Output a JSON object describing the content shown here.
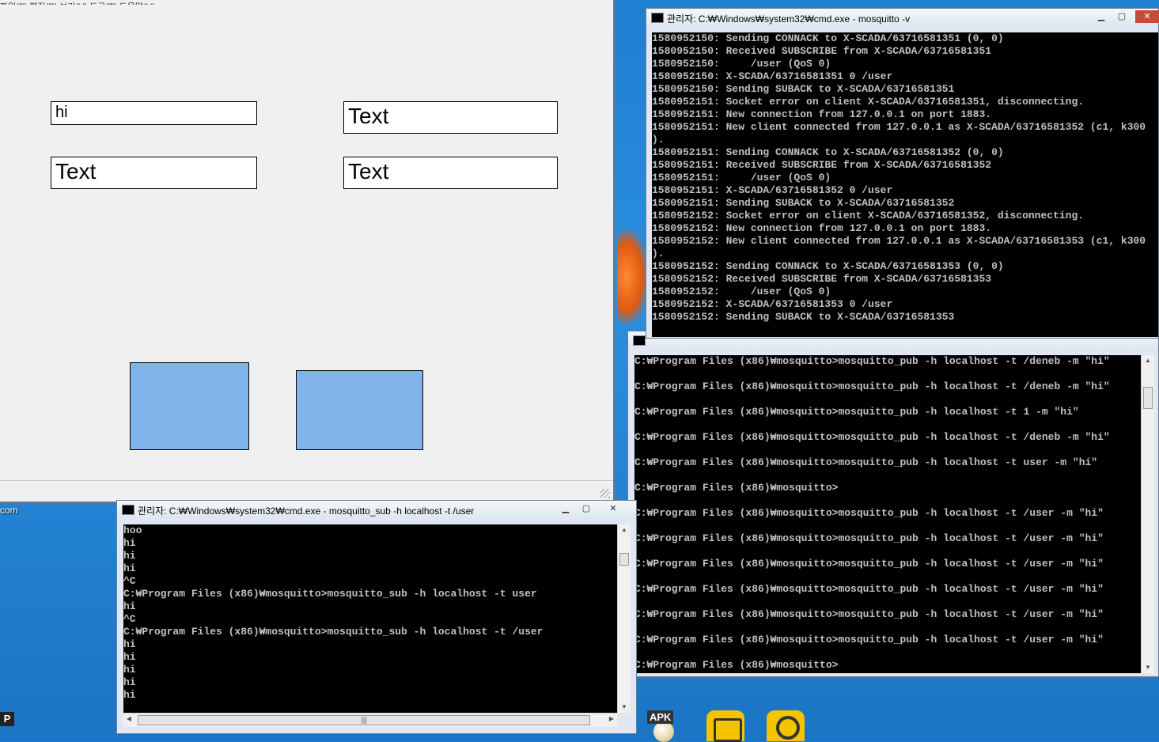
{
  "desktop": {
    "left_label": "com",
    "p_label": "P",
    "apk_label": "APK"
  },
  "form_window": {
    "menu_text": "파일(F)   편집(E)   보기(V)   도구(T)   도움말(H)",
    "textbox_top_left": "hi",
    "textbox_top_right": "Text",
    "textbox_bottom_left": "Text",
    "textbox_bottom_right": "Text",
    "button_color": "#7fb3ea"
  },
  "cmd_server": {
    "title": "관리자: C:₩Windows₩system32₩cmd.exe - mosquitto  -v",
    "lines": [
      "1580952150: Sending CONNACK to X-SCADA/63716581351 (0, 0)",
      "1580952150: Received SUBSCRIBE from X-SCADA/63716581351",
      "1580952150:     /user (QoS 0)",
      "1580952150: X-SCADA/63716581351 0 /user",
      "1580952150: Sending SUBACK to X-SCADA/63716581351",
      "1580952151: Socket error on client X-SCADA/63716581351, disconnecting.",
      "1580952151: New connection from 127.0.0.1 on port 1883.",
      "1580952151: New client connected from 127.0.0.1 as X-SCADA/63716581352 (c1, k300",
      ").",
      "1580952151: Sending CONNACK to X-SCADA/63716581352 (0, 0)",
      "1580952151: Received SUBSCRIBE from X-SCADA/63716581352",
      "1580952151:     /user (QoS 0)",
      "1580952151: X-SCADA/63716581352 0 /user",
      "1580952151: Sending SUBACK to X-SCADA/63716581352",
      "1580952152: Socket error on client X-SCADA/63716581352, disconnecting.",
      "1580952152: New connection from 127.0.0.1 on port 1883.",
      "1580952152: New client connected from 127.0.0.1 as X-SCADA/63716581353 (c1, k300",
      ").",
      "1580952152: Sending CONNACK to X-SCADA/63716581353 (0, 0)",
      "1580952152: Received SUBSCRIBE from X-SCADA/63716581353",
      "1580952152:     /user (QoS 0)",
      "1580952152: X-SCADA/63716581353 0 /user",
      "1580952152: Sending SUBACK to X-SCADA/63716581353"
    ]
  },
  "cmd_pub": {
    "title": "",
    "lines": [
      "C:₩Program Files (x86)₩mosquitto>mosquitto_pub -h localhost -t /deneb -m \"hi\"",
      "",
      "C:₩Program Files (x86)₩mosquitto>mosquitto_pub -h localhost -t /deneb -m \"hi\"",
      "",
      "C:₩Program Files (x86)₩mosquitto>mosquitto_pub -h localhost -t 1 -m \"hi\"",
      "",
      "C:₩Program Files (x86)₩mosquitto>mosquitto_pub -h localhost -t /deneb -m \"hi\"",
      "",
      "C:₩Program Files (x86)₩mosquitto>mosquitto_pub -h localhost -t user -m \"hi\"",
      "",
      "C:₩Program Files (x86)₩mosquitto>",
      "",
      "C:₩Program Files (x86)₩mosquitto>mosquitto_pub -h localhost -t /user -m \"hi\"",
      "",
      "C:₩Program Files (x86)₩mosquitto>mosquitto_pub -h localhost -t /user -m \"hi\"",
      "",
      "C:₩Program Files (x86)₩mosquitto>mosquitto_pub -h localhost -t /user -m \"hi\"",
      "",
      "C:₩Program Files (x86)₩mosquitto>mosquitto_pub -h localhost -t /user -m \"hi\"",
      "",
      "C:₩Program Files (x86)₩mosquitto>mosquitto_pub -h localhost -t /user -m \"hi\"",
      "",
      "C:₩Program Files (x86)₩mosquitto>mosquitto_pub -h localhost -t /user -m \"hi\"",
      "",
      "C:₩Program Files (x86)₩mosquitto>"
    ]
  },
  "cmd_sub": {
    "title": "관리자: C:₩Windows₩system32₩cmd.exe - mosquitto_sub  -h localhost -t /user",
    "lines": [
      "hoo",
      "hi",
      "hi",
      "hi",
      "^C",
      "C:₩Program Files (x86)₩mosquitto>mosquitto_sub -h localhost -t user",
      "hi",
      "^C",
      "C:₩Program Files (x86)₩mosquitto>mosquitto_sub -h localhost -t /user",
      "hi",
      "hi",
      "hi",
      "hi",
      "hi"
    ]
  }
}
